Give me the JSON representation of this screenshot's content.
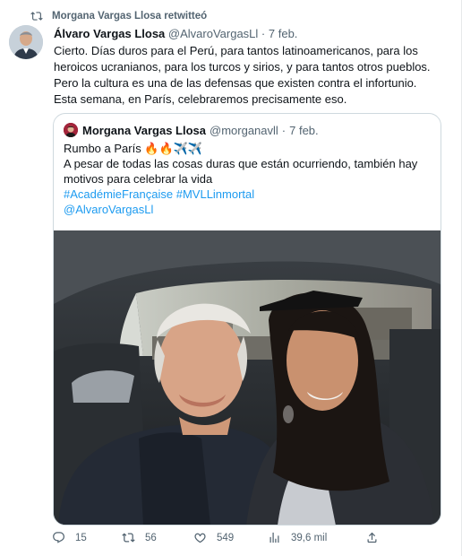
{
  "retweet": {
    "label": "Morgana Vargas Llosa retwitteó"
  },
  "tweet": {
    "author_name": "Álvaro Vargas Llosa",
    "author_handle": "@AlvaroVargasLl",
    "separator": "·",
    "date": "7 feb.",
    "text_lines": [
      "Cierto. Días duros para el Perú, para tantos latinoamericanos, para los",
      "heroicos ucranianos, para los turcos y sirios, y para tantos otros pueblos.",
      "Pero la cultura es una de las defensas que existen contra el infortunio.",
      "Esta semana, en París, celebraremos precisamente eso."
    ]
  },
  "quote": {
    "author_name": "Morgana Vargas Llosa",
    "author_handle": "@morganavll",
    "separator": "·",
    "date": "7 feb.",
    "lines": [
      "Rumbo a París 🔥🔥✈️✈️",
      "A pesar de todas las cosas duras que están ocurriendo, también hay",
      "motivos para celebrar la vida"
    ],
    "tags": [
      "#AcadémieFrançaise #MVLLinmortal",
      "@AlvaroVargasLl"
    ]
  },
  "actions": {
    "replies": "15",
    "retweets": "56",
    "likes": "549",
    "views": "39,6 mil"
  },
  "colors": {
    "link": "#1d9bf0",
    "secondary_text": "#536471",
    "primary_text": "#0f1419",
    "border": "#cfd9de"
  },
  "icons": {
    "retweet": "retweet-icon",
    "reply": "reply-icon",
    "like": "heart-icon",
    "views": "views-icon",
    "share": "share-icon"
  }
}
